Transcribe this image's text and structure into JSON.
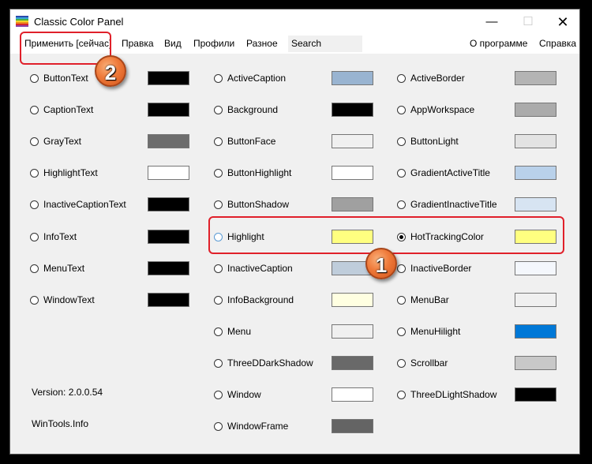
{
  "window": {
    "title": "Classic Color Panel",
    "minimize_glyph": "—",
    "maximize_glyph": "☐",
    "close_glyph": "✕"
  },
  "app_icon_colors": [
    "#2b4aad",
    "#3aa4d8",
    "#47b044",
    "#f3d22a",
    "#f08c1c",
    "#d8262c",
    "#8a3fa6"
  ],
  "menu": {
    "apply": "Применить [сейчас]",
    "edit": "Правка",
    "view": "Вид",
    "profiles": "Профили",
    "misc": "Разное",
    "search_placeholder": "Search",
    "about": "О программе",
    "help": "Справка"
  },
  "columns": [
    [
      {
        "name": "ButtonText",
        "color": "#000000",
        "selected": false
      },
      {
        "name": "CaptionText",
        "color": "#000000",
        "selected": false
      },
      {
        "name": "GrayText",
        "color": "#6d6d6d",
        "selected": false
      },
      {
        "name": "HighlightText",
        "color": "#ffffff",
        "selected": false
      },
      {
        "name": "InactiveCaptionText",
        "color": "#000000",
        "selected": false
      },
      {
        "name": "InfoText",
        "color": "#000000",
        "selected": false
      },
      {
        "name": "MenuText",
        "color": "#000000",
        "selected": false
      },
      {
        "name": "WindowText",
        "color": "#000000",
        "selected": false
      }
    ],
    [
      {
        "name": "ActiveCaption",
        "color": "#99b4d1",
        "selected": false
      },
      {
        "name": "Background",
        "color": "#000000",
        "selected": false
      },
      {
        "name": "ButtonFace",
        "color": "#f0f0f0",
        "selected": false
      },
      {
        "name": "ButtonHighlight",
        "color": "#ffffff",
        "selected": false
      },
      {
        "name": "ButtonShadow",
        "color": "#a0a0a0",
        "selected": false
      },
      {
        "name": "Highlight",
        "color": "#ffff80",
        "selected": false,
        "highlighted": true
      },
      {
        "name": "InactiveCaption",
        "color": "#bfcddb",
        "selected": false
      },
      {
        "name": "InfoBackground",
        "color": "#ffffe1",
        "selected": false
      },
      {
        "name": "Menu",
        "color": "#f0f0f0",
        "selected": false
      },
      {
        "name": "ThreeDDarkShadow",
        "color": "#696969",
        "selected": false
      },
      {
        "name": "Window",
        "color": "#ffffff",
        "selected": false
      },
      {
        "name": "WindowFrame",
        "color": "#646464",
        "selected": false
      }
    ],
    [
      {
        "name": "ActiveBorder",
        "color": "#b4b4b4",
        "selected": false
      },
      {
        "name": "AppWorkspace",
        "color": "#ababab",
        "selected": false
      },
      {
        "name": "ButtonLight",
        "color": "#e3e3e3",
        "selected": false
      },
      {
        "name": "GradientActiveTitle",
        "color": "#b9d1ea",
        "selected": false
      },
      {
        "name": "GradientInactiveTitle",
        "color": "#d7e4f2",
        "selected": false
      },
      {
        "name": "HotTrackingColor",
        "color": "#ffff80",
        "selected": true
      },
      {
        "name": "InactiveBorder",
        "color": "#f4f7fc",
        "selected": false
      },
      {
        "name": "MenuBar",
        "color": "#f0f0f0",
        "selected": false
      },
      {
        "name": "MenuHilight",
        "color": "#0078d7",
        "selected": false
      },
      {
        "name": "Scrollbar",
        "color": "#c8c8c8",
        "selected": false
      },
      {
        "name": "ThreeDLightShadow",
        "color": "#000000",
        "selected": false
      }
    ]
  ],
  "footer": {
    "version": "Version: 2.0.0.54",
    "site": "WinTools.Info"
  },
  "annotations": {
    "badge_1": "1",
    "badge_2": "2",
    "highlight_color": "#e0202a"
  }
}
